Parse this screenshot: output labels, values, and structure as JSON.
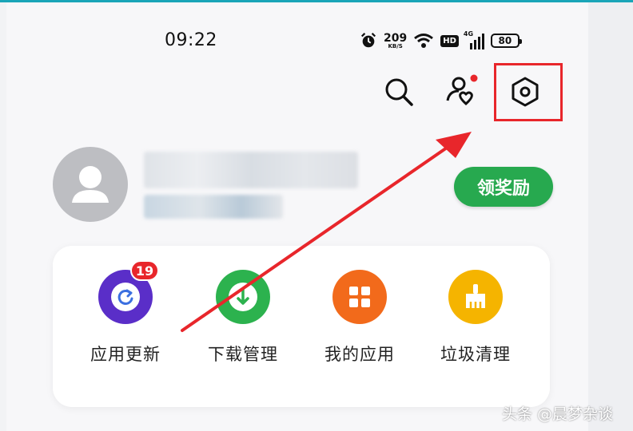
{
  "status_bar": {
    "time": "09:22",
    "net_speed": "209",
    "net_speed_unit": "KB/S",
    "hd_label": "HD",
    "network_type": "4G",
    "battery": "80"
  },
  "header_actions": {
    "search_icon": "search-icon",
    "friends_icon": "user-heart-icon",
    "settings_icon": "settings-hexagon-icon"
  },
  "profile": {
    "reward_button": "领奖励"
  },
  "quick_actions": [
    {
      "label": "应用更新",
      "icon": "refresh-icon",
      "color": "#5a2ec8",
      "badge": "19"
    },
    {
      "label": "下载管理",
      "icon": "download-icon",
      "color": "#2cb24e"
    },
    {
      "label": "我的应用",
      "icon": "grid-icon",
      "color": "#f26a1b"
    },
    {
      "label": "垃圾清理",
      "icon": "broom-icon",
      "color": "#f5b400"
    }
  ],
  "annotation": {
    "highlight_color": "#e8262b"
  },
  "watermark": "头条 @晨梦杂谈"
}
